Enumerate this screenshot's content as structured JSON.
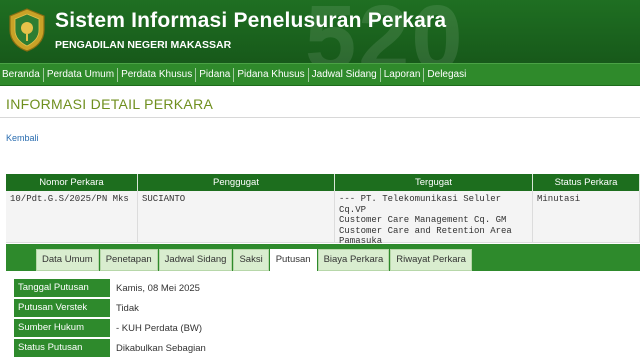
{
  "header": {
    "watermark": "520",
    "title": "Sistem Informasi Penelusuran Perkara",
    "subtitle": "PENGADILAN NEGERI MAKASSAR"
  },
  "nav": {
    "items": [
      "Beranda",
      "Perdata Umum",
      "Perdata Khusus",
      "Pidana",
      "Pidana Khusus",
      "Jadwal Sidang",
      "Laporan",
      "Delegasi"
    ]
  },
  "page": {
    "title": "INFORMASI DETAIL PERKARA",
    "back_label": "Kembali"
  },
  "summary": {
    "headers": [
      "Nomor Perkara",
      "Penggugat",
      "Tergugat",
      "Status Perkara"
    ],
    "row": {
      "nomor": "10/Pdt.G.S/2025/PN Mks",
      "penggugat": "SUCIANTO",
      "tergugat_lines": [
        "--- PT. Telekomunikasi Seluler Cq.VP",
        "Customer Care Management Cq. GM",
        "Customer Care and Retention Area",
        "Pamasuka"
      ],
      "status": "Minutasi"
    }
  },
  "tabs": {
    "items": [
      "Data Umum",
      "Penetapan",
      "Jadwal Sidang",
      "Saksi",
      "Putusan",
      "Biaya Perkara",
      "Riwayat Perkara"
    ],
    "active": "Putusan"
  },
  "putusan": {
    "rows": [
      {
        "label": "Tanggal Putusan",
        "value": "Kamis, 08 Mei 2025"
      },
      {
        "label": "Putusan Verstek",
        "value": "Tidak"
      },
      {
        "label": "Sumber Hukum",
        "value": "- KUH Perdata (BW)"
      },
      {
        "label": "Status Putusan",
        "value": "Dikabulkan Sebagian"
      }
    ]
  },
  "colors": {
    "header_green": "#1f6f22",
    "nav_green": "#2f8a2b",
    "title_olive": "#6f8f1e",
    "link_blue": "#2a6db0"
  },
  "icons": {
    "logo": "court-emblem-icon"
  }
}
